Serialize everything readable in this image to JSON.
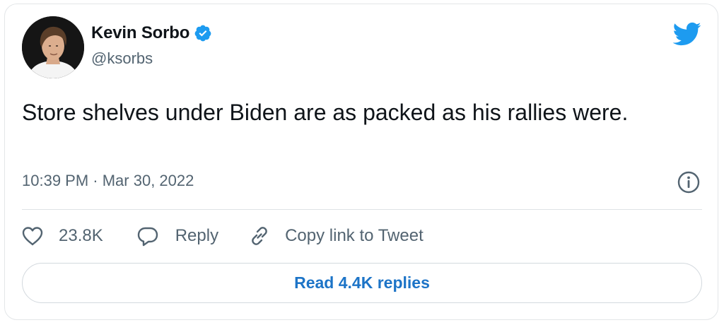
{
  "author": {
    "display_name": "Kevin Sorbo",
    "handle": "@ksorbs",
    "verified": true
  },
  "tweet": {
    "text": "Store shelves under Biden are as packed as his rallies were.",
    "timestamp": "10:39 PM · Mar 30, 2022"
  },
  "actions": {
    "like_count": "23.8K",
    "reply_label": "Reply",
    "copy_label": "Copy link to Tweet"
  },
  "footer": {
    "read_replies_label": "Read 4.4K replies"
  },
  "colors": {
    "brand_blue": "#1d9bf0",
    "link_blue": "#1d74c7",
    "muted_text": "#536471"
  },
  "icons": [
    "verified-badge-icon",
    "twitter-bird-icon",
    "info-icon",
    "heart-icon",
    "reply-bubble-icon",
    "link-icon"
  ]
}
